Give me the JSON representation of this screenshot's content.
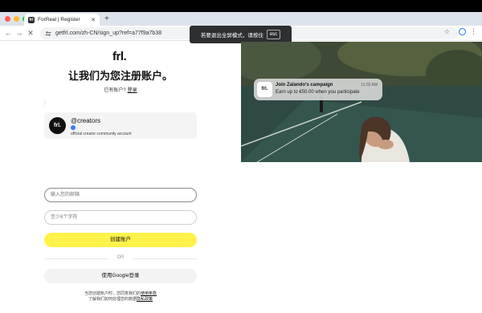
{
  "browser": {
    "tab_title": "ForReal | Register",
    "tab_favicon_text": "frl",
    "new_tab": "+",
    "tab_close": "✕",
    "back": "←",
    "forward": "→",
    "reload": "✕",
    "url": "getfrl.com/zh-CN/sign_up?ref=a77f9a7b38",
    "star": "☆",
    "menu": "⋮"
  },
  "fullscreen_toast": {
    "text": "若要退出全屏模式，请按住",
    "key": "esc"
  },
  "page": {
    "logo": "frl.",
    "title": "让我们为您注册账户。",
    "have_account": "已有账户?",
    "login": "登录",
    "colon": ":",
    "referrer": {
      "avatar_text": "frl.",
      "handle": "@creators",
      "description": "official creator community account"
    },
    "email_placeholder": "输入您的邮箱",
    "password_placeholder": "至少6个字符",
    "create_button": "创建账户",
    "or": "OR",
    "google_button": "使用Google登录",
    "legal_line1": "当您创建账户时，您同意我们的",
    "terms": "使用条款",
    "legal_line2": "了解我们如何处理您的数据",
    "privacy": "隐私政策"
  },
  "notification": {
    "icon_text": "frl.",
    "title": "Join Zalando's campaign",
    "time": "11:02 AM",
    "body": "Earn up to €50.00 when you participate"
  },
  "colors": {
    "accent_yellow": "#fff24a",
    "verified_blue": "#3a7bfa"
  }
}
